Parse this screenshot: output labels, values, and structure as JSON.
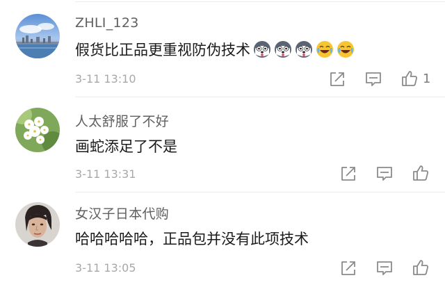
{
  "comments": [
    {
      "username": "ZHLI_123",
      "text": "假货比正品更重视防伪技术",
      "time": "3-11 13:10",
      "likes": "1",
      "emojis": [
        "husky-emoji",
        "husky-emoji",
        "husky-emoji",
        "laughing-crying-emoji",
        "laughing-crying-emoji"
      ]
    },
    {
      "username": "人太舒服了不好",
      "text": "画蛇添足了不是",
      "time": "3-11 13:31",
      "likes": ""
    },
    {
      "username": "女汉子日本代购",
      "text": "哈哈哈哈哈，正品包并没有此项技术",
      "time": "3-11 13:05",
      "likes": ""
    }
  ],
  "icons": {
    "share": "share-icon",
    "reply": "comment-icon",
    "like": "thumbs-up-icon"
  },
  "colors": {
    "username": "#5f5f5f",
    "text": "#1a1a1a",
    "timestamp": "#a8a8a8",
    "icon": "#8a8a8a"
  }
}
